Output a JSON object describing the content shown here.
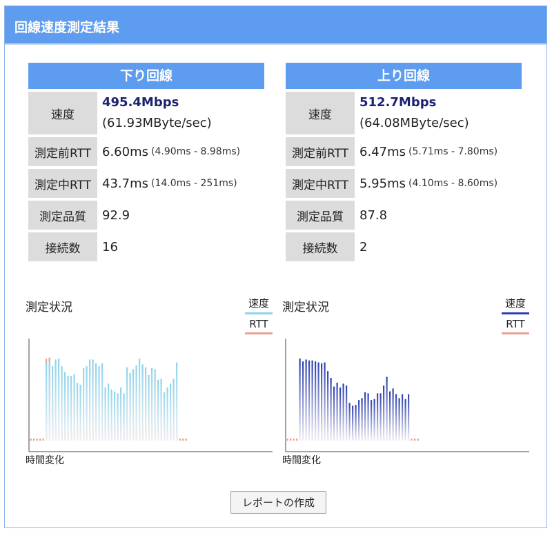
{
  "header": {
    "title": "回線速度測定結果"
  },
  "colors": {
    "accent": "#5d9cef",
    "speed_down": "#8dd3ea",
    "speed_up": "#2b3fae",
    "rtt": "#e8a092"
  },
  "down": {
    "title": "下り回線",
    "speed_label": "速度",
    "speed_main": "495.4Mbps",
    "speed_sub": "(61.93MByte/sec)",
    "rtt_before_label": "測定前RTT",
    "rtt_before": "6.60ms",
    "rtt_before_range": "(4.90ms - 8.98ms)",
    "rtt_during_label": "測定中RTT",
    "rtt_during": "43.7ms",
    "rtt_during_range": "(14.0ms - 251ms)",
    "quality_label": "測定品質",
    "quality": "92.9",
    "connections_label": "接続数",
    "connections": "16"
  },
  "up": {
    "title": "上り回線",
    "speed_label": "速度",
    "speed_main": "512.7Mbps",
    "speed_sub": "(64.08MByte/sec)",
    "rtt_before_label": "測定前RTT",
    "rtt_before": "6.47ms",
    "rtt_before_range": "(5.71ms - 7.80ms)",
    "rtt_during_label": "測定中RTT",
    "rtt_during": "5.95ms",
    "rtt_during_range": "(4.10ms - 8.60ms)",
    "quality_label": "測定品質",
    "quality": "87.8",
    "connections_label": "接続数",
    "connections": "2"
  },
  "charts": {
    "title": "測定状況",
    "legend_speed": "速度",
    "legend_rtt": "RTT",
    "xlabel": "時間変化"
  },
  "chart_data": [
    {
      "type": "bar",
      "series": [
        {
          "values": [
            0.02,
            0.02,
            0.02,
            0.02,
            0.02,
            0.8,
            0.82,
            0.77,
            0.84,
            0.85,
            0.77,
            0.71,
            0.67,
            0.67,
            0.69,
            0.6,
            0.58,
            0.75,
            0.77,
            0.84,
            0.84,
            0.8,
            0.77,
            0.8,
            0.55,
            0.59,
            0.53,
            0.51,
            0.49,
            0.55,
            0.49,
            0.76,
            0.7,
            0.74,
            0.78,
            0.85,
            0.79,
            0.76,
            0.68,
            0.75,
            0.74,
            0.63,
            0.64,
            0.5,
            0.55,
            0.59,
            0.64,
            0.81,
            0.02,
            0.02,
            0.02
          ]
        },
        {
          "values": [
            0.02,
            0.02,
            0.02,
            0.02,
            0.02,
            0.85,
            0.86,
            0.42,
            0.16,
            0.1,
            0.1,
            0.12,
            0.09,
            0.09,
            0.1,
            0.13,
            0.12,
            0.12,
            0.12,
            0.12,
            0.11,
            0.1,
            0.14,
            0.15,
            0.16,
            0.16,
            0.16,
            0.15,
            0.14,
            0.16,
            0.11,
            0.14,
            0.14,
            0.15,
            0.14,
            0.16,
            0.14,
            0.14,
            0.15,
            0.14,
            0.14,
            0.14,
            0.15,
            0.16,
            0.16,
            0.16,
            0.15,
            0.16,
            0.02,
            0.02,
            0.02
          ]
        }
      ]
    },
    {
      "type": "bar",
      "series": [
        {
          "values": [
            0.02,
            0.02,
            0.02,
            0.02,
            0.85,
            0.82,
            0.84,
            0.83,
            0.83,
            0.82,
            0.81,
            0.8,
            0.81,
            0.72,
            0.65,
            0.56,
            0.6,
            0.55,
            0.59,
            0.57,
            0.39,
            0.36,
            0.37,
            0.42,
            0.44,
            0.5,
            0.49,
            0.42,
            0.43,
            0.49,
            0.49,
            0.57,
            0.66,
            0.51,
            0.54,
            0.48,
            0.44,
            0.48,
            0.43,
            0.48,
            0.02,
            0.02,
            0.02
          ]
        },
        {
          "values": [
            0.02,
            0.02,
            0.02,
            0.02,
            0.02,
            0.02,
            0.02,
            0.02,
            0.02,
            0.02,
            0.02,
            0.02,
            0.02,
            0.02,
            0.02,
            0.02,
            0.02,
            0.02,
            0.02,
            0.02,
            0.02,
            0.02,
            0.02,
            0.02,
            0.02,
            0.02,
            0.02,
            0.02,
            0.02,
            0.02,
            0.02,
            0.02,
            0.02,
            0.02,
            0.02,
            0.02,
            0.02,
            0.02,
            0.02,
            0.02,
            0.02,
            0.02,
            0.02
          ]
        }
      ]
    }
  ]
}
